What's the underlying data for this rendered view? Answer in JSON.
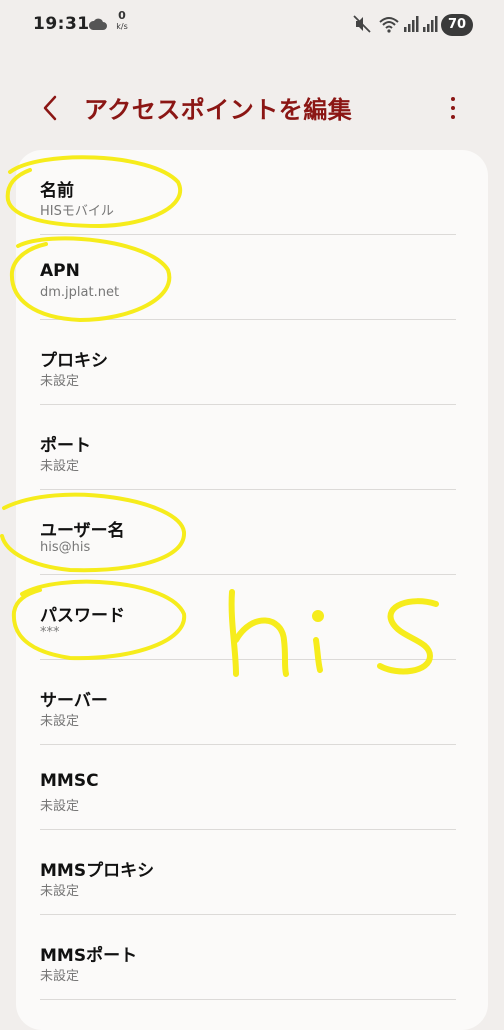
{
  "status_bar": {
    "time": "19:31",
    "net_speed_value": "0",
    "net_speed_unit": "k/s",
    "battery": "70"
  },
  "app_bar": {
    "title": "アクセスポイントを編集"
  },
  "settings": [
    {
      "title": "名前",
      "value": "HISモバイル"
    },
    {
      "title": "APN",
      "value": "dm.jplat.net"
    },
    {
      "title": "プロキシ",
      "value": "未設定"
    },
    {
      "title": "ポート",
      "value": "未設定"
    },
    {
      "title": "ユーザー名",
      "value": "his@his"
    },
    {
      "title": "パスワード",
      "value": "***"
    },
    {
      "title": "サーバー",
      "value": "未設定"
    },
    {
      "title": "MMSC",
      "value": "未設定"
    },
    {
      "title": "MMSプロキシ",
      "value": "未設定"
    },
    {
      "title": "MMSポート",
      "value": "未設定"
    }
  ],
  "handwritten_note": "his",
  "colors": {
    "accent": "#8b1614",
    "highlight": "#f6ec1c",
    "card_background": "#fbfaf9",
    "page_background": "#f1eeec"
  }
}
